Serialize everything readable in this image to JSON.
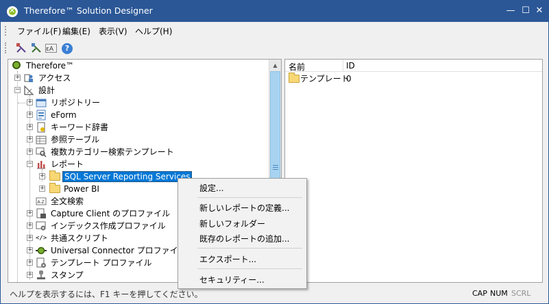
{
  "window": {
    "title": "Therefore™ Solution Designer",
    "minimize": "—",
    "maximize": "☐",
    "close": "✕"
  },
  "menu": [
    "ファイル(F)",
    "編集(E)",
    "表示(V)",
    "ヘルプ(H)"
  ],
  "toolbar": {
    "icons": [
      "designer-tool-icon",
      "designer-tool-2-icon",
      "text-replace-icon",
      "help-icon"
    ],
    "help_glyph": "?"
  },
  "tree": {
    "root": "Therefore™",
    "items": [
      {
        "label": "アクセス",
        "icon": "access-icon"
      },
      {
        "label": "設計",
        "icon": "design-icon"
      },
      {
        "label": "リポジトリー",
        "icon": "repository-icon"
      },
      {
        "label": "eForm",
        "icon": "eform-icon"
      },
      {
        "label": "キーワード辞書",
        "icon": "keyword-dictionary-icon"
      },
      {
        "label": "参照テーブル",
        "icon": "reference-table-icon"
      },
      {
        "label": "複数カテゴリー検索テンプレート",
        "icon": "search-template-icon"
      },
      {
        "label": "レポート",
        "icon": "report-icon"
      },
      {
        "label": "SQL Server Reporting Services",
        "icon": "folder-icon"
      },
      {
        "label": "Power BI",
        "icon": "folder-icon"
      },
      {
        "label": "全文検索",
        "icon": "fulltext-search-icon"
      },
      {
        "label": "Capture Client のプロファイル",
        "icon": "capture-client-icon"
      },
      {
        "label": "インデックス作成プロファイル",
        "icon": "index-profile-icon"
      },
      {
        "label": "共通スクリプト",
        "icon": "script-icon"
      },
      {
        "label": "Universal Connector プロファイル",
        "icon": "connector-icon"
      },
      {
        "label": "テンプレート プロファイル",
        "icon": "template-profile-icon"
      },
      {
        "label": "スタンプ",
        "icon": "stamp-icon"
      }
    ]
  },
  "list": {
    "columns": [
      "名前",
      "ID"
    ],
    "rows": [
      {
        "name": "テンプレート",
        "id": "0"
      }
    ]
  },
  "context_menu": [
    "設定...",
    "新しいレポートの定義...",
    "新しいフォルダー",
    "既存のレポートの追加...",
    "エクスポート...",
    "セキュリティー..."
  ],
  "status": {
    "text": "ヘルプを表示するには、F1 キーを押してください。",
    "cap": "CAP",
    "num": "NUM",
    "scrl": "SCRL"
  },
  "colors": {
    "titlebar": "#2b5797",
    "selection": "#0078d7",
    "scroll_thumb": "#a8d3f0"
  }
}
